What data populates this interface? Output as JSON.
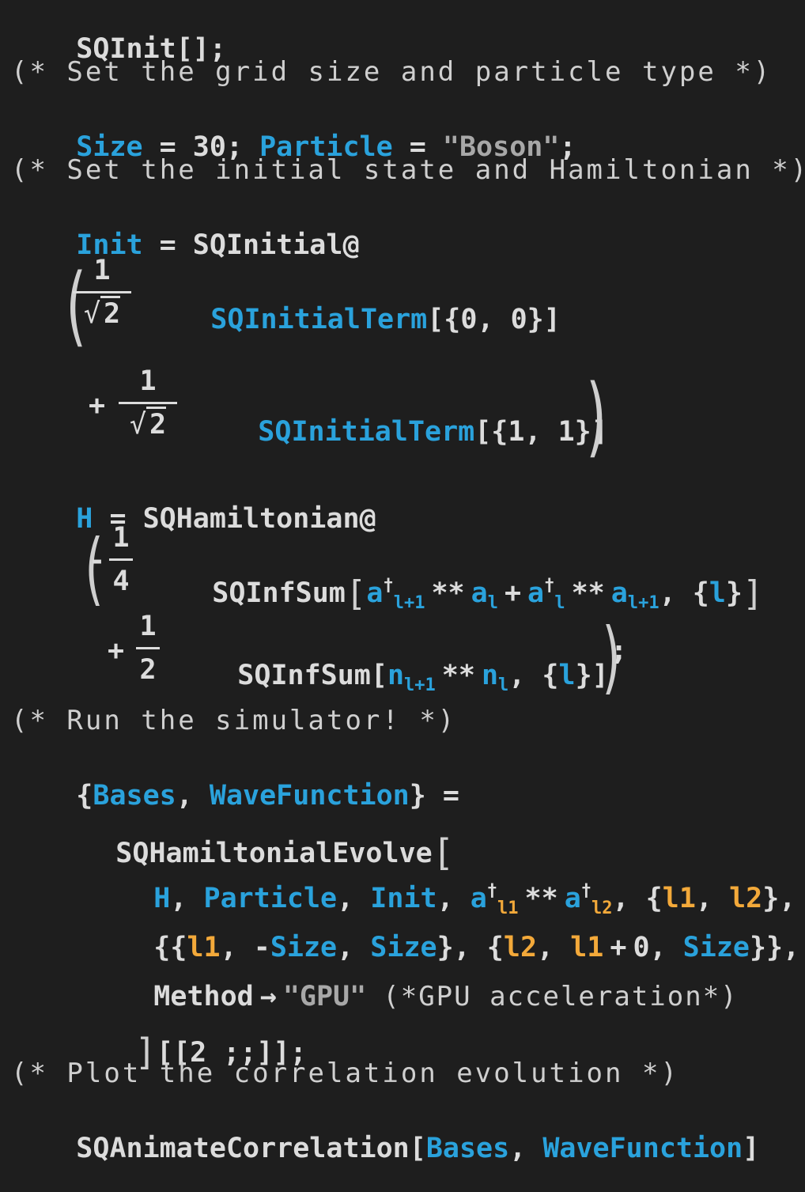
{
  "l1": {
    "a": "SQInit[];"
  },
  "c1": "(* Set the grid size and particle type *)",
  "l3": {
    "size": "Size",
    "eq1": " = 30; ",
    "particle": "Particle",
    "eq2": " = ",
    "boson": "\"Boson\"",
    "semi": ";"
  },
  "c2": "(* Set the initial state and Hamiltonian *)",
  "l5": {
    "init": "Init",
    "rest": " = SQInitial@"
  },
  "t1": {
    "one": "1",
    "two": "2",
    "term": "SQInitialTerm",
    "args": "[{0, 0}]"
  },
  "t2": {
    "plus": "+",
    "one": "1",
    "two": "2",
    "term": "SQInitialTerm",
    "args": "[{1, 1}]"
  },
  "l8": {
    "h": "H",
    "rest": " = SQHamiltonian@"
  },
  "h1": {
    "minus": "-",
    "one": "1",
    "four": "4",
    "fn": "SQInfSum",
    "a": "a",
    "dag": "†",
    "l1": "l+1",
    "star": "**",
    "l": "l",
    "plus": "+",
    "comma": ",",
    "braceL": "{",
    "braceR": "}"
  },
  "h2": {
    "plus": "+",
    "one": "1",
    "two": "2",
    "fn": "SQInfSum[",
    "n": "n",
    "l1": "l+1",
    "star": "**",
    "l": "l",
    "tail": ", {",
    "tail2": "}]",
    "semi": ";"
  },
  "c3": "(* Run the simulator! *)",
  "l12": {
    "open": "{",
    "bases": "Bases",
    "comma": ", ",
    "wave": "WaveFunction",
    "close": "} ="
  },
  "l13": {
    "fn": "SQHamiltonialEvolve"
  },
  "l14": {
    "h": "H",
    "particle": "Particle",
    "init": "Init",
    "a": "a",
    "dag": "†",
    "s1": "l1",
    "s2": "l2",
    "star": "**",
    "v1": "l1",
    "v2": "l2"
  },
  "l15": {
    "v1": "l1",
    "minus": "-",
    "size": "Size",
    "v2": "l2",
    "v1b": "l1",
    "plus": "+",
    "zero": "0"
  },
  "l16": {
    "method": "Method",
    "arrow": "→",
    "gpu": "\"GPU\"",
    "comment": "(*GPU acceleration*)"
  },
  "l17": {
    "text": "[[2 ;;]];"
  },
  "c4": "(* Plot the correlation evolution *)",
  "l19": {
    "fn": "SQAnimateCorrelation[",
    "bases": "Bases",
    "comma": ", ",
    "wave": "WaveFunction",
    "close": "]"
  }
}
